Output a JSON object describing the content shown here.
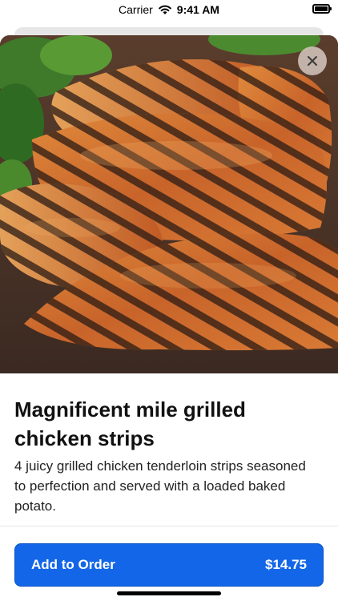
{
  "status_bar": {
    "carrier": "Carrier",
    "time": "9:41 AM"
  },
  "item": {
    "image_icon": "grilled-chicken-photo",
    "title": "Magnificent mile grilled chicken strips",
    "description": "4 juicy grilled chicken tenderloin strips seasoned to perfection and served with a loaded baked potato."
  },
  "close": {
    "icon": "close-icon"
  },
  "order": {
    "button_label": "Add to Order",
    "price": "$14.75"
  },
  "colors": {
    "accent": "#1366e8",
    "close_bg": "#d6c8c0"
  }
}
